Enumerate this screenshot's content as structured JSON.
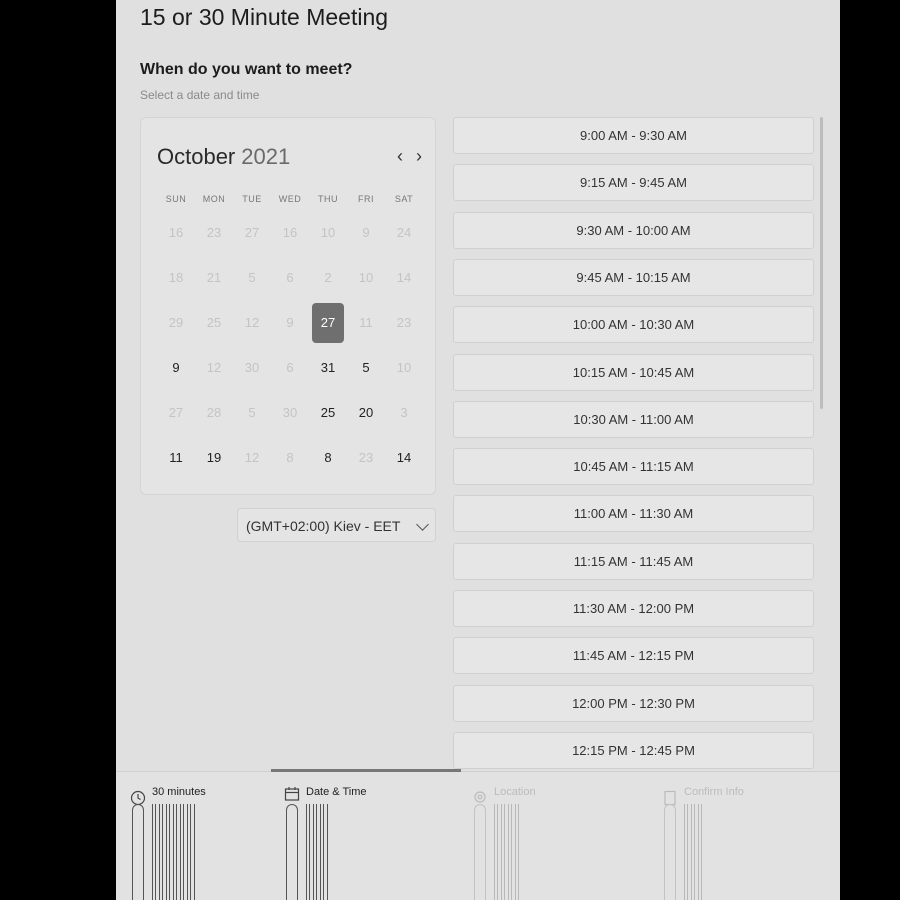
{
  "page": {
    "title": "15 or 30 Minute Meeting",
    "prompt": "When do you want to meet?",
    "subprompt": "Select a date and time"
  },
  "calendar": {
    "month": "October",
    "year": "2021",
    "prev_icon": "chevron-left-icon",
    "next_icon": "chevron-right-icon",
    "weekdays": [
      "SUN",
      "MON",
      "TUE",
      "WED",
      "THU",
      "FRI",
      "SAT"
    ],
    "weeks": [
      [
        "16",
        "23",
        "27",
        "16",
        "10",
        "9",
        "24"
      ],
      [
        "18",
        "21",
        "5",
        "6",
        "2",
        "10",
        "14"
      ],
      [
        "29",
        "25",
        "12",
        "9",
        "27",
        "11",
        "23"
      ],
      [
        "9",
        "12",
        "30",
        "6",
        "31",
        "5",
        "10"
      ],
      [
        "27",
        "28",
        "5",
        "30",
        "25",
        "20",
        "3"
      ],
      [
        "11",
        "19",
        "12",
        "8",
        "8",
        "23",
        "14"
      ]
    ],
    "active_cells": [
      [
        2,
        4
      ],
      [
        3,
        0
      ],
      [
        3,
        4
      ],
      [
        3,
        5
      ],
      [
        4,
        4
      ],
      [
        4,
        5
      ],
      [
        5,
        0
      ],
      [
        5,
        1
      ],
      [
        5,
        4
      ],
      [
        5,
        6
      ]
    ],
    "selected": [
      2,
      4
    ],
    "accent_color": "#6f6f6f"
  },
  "timezone": {
    "label": "(GMT+02:00) Kiev - EET",
    "icon": "chevron-down-icon"
  },
  "slots": [
    "9:00 AM - 9:30 AM",
    "9:15 AM - 9:45 AM",
    "9:30 AM - 10:00 AM",
    "9:45 AM - 10:15 AM",
    "10:00 AM - 10:30 AM",
    "10:15 AM - 10:45 AM",
    "10:30 AM - 11:00 AM",
    "10:45 AM - 11:15 AM",
    "11:00 AM - 11:30 AM",
    "11:15 AM - 11:45 AM",
    "11:30 AM - 12:00 PM",
    "11:45 AM - 12:15 PM",
    "12:00 PM - 12:30 PM",
    "12:15 PM - 12:45 PM"
  ],
  "steps": [
    {
      "label": "30 minutes",
      "icon": "clock-icon",
      "state": "done"
    },
    {
      "label": "Date & Time",
      "icon": "calendar-icon",
      "state": "current"
    },
    {
      "label": "Location",
      "icon": "location-pin-icon",
      "state": "todo"
    },
    {
      "label": "Confirm Info",
      "icon": "document-icon",
      "state": "todo"
    }
  ]
}
